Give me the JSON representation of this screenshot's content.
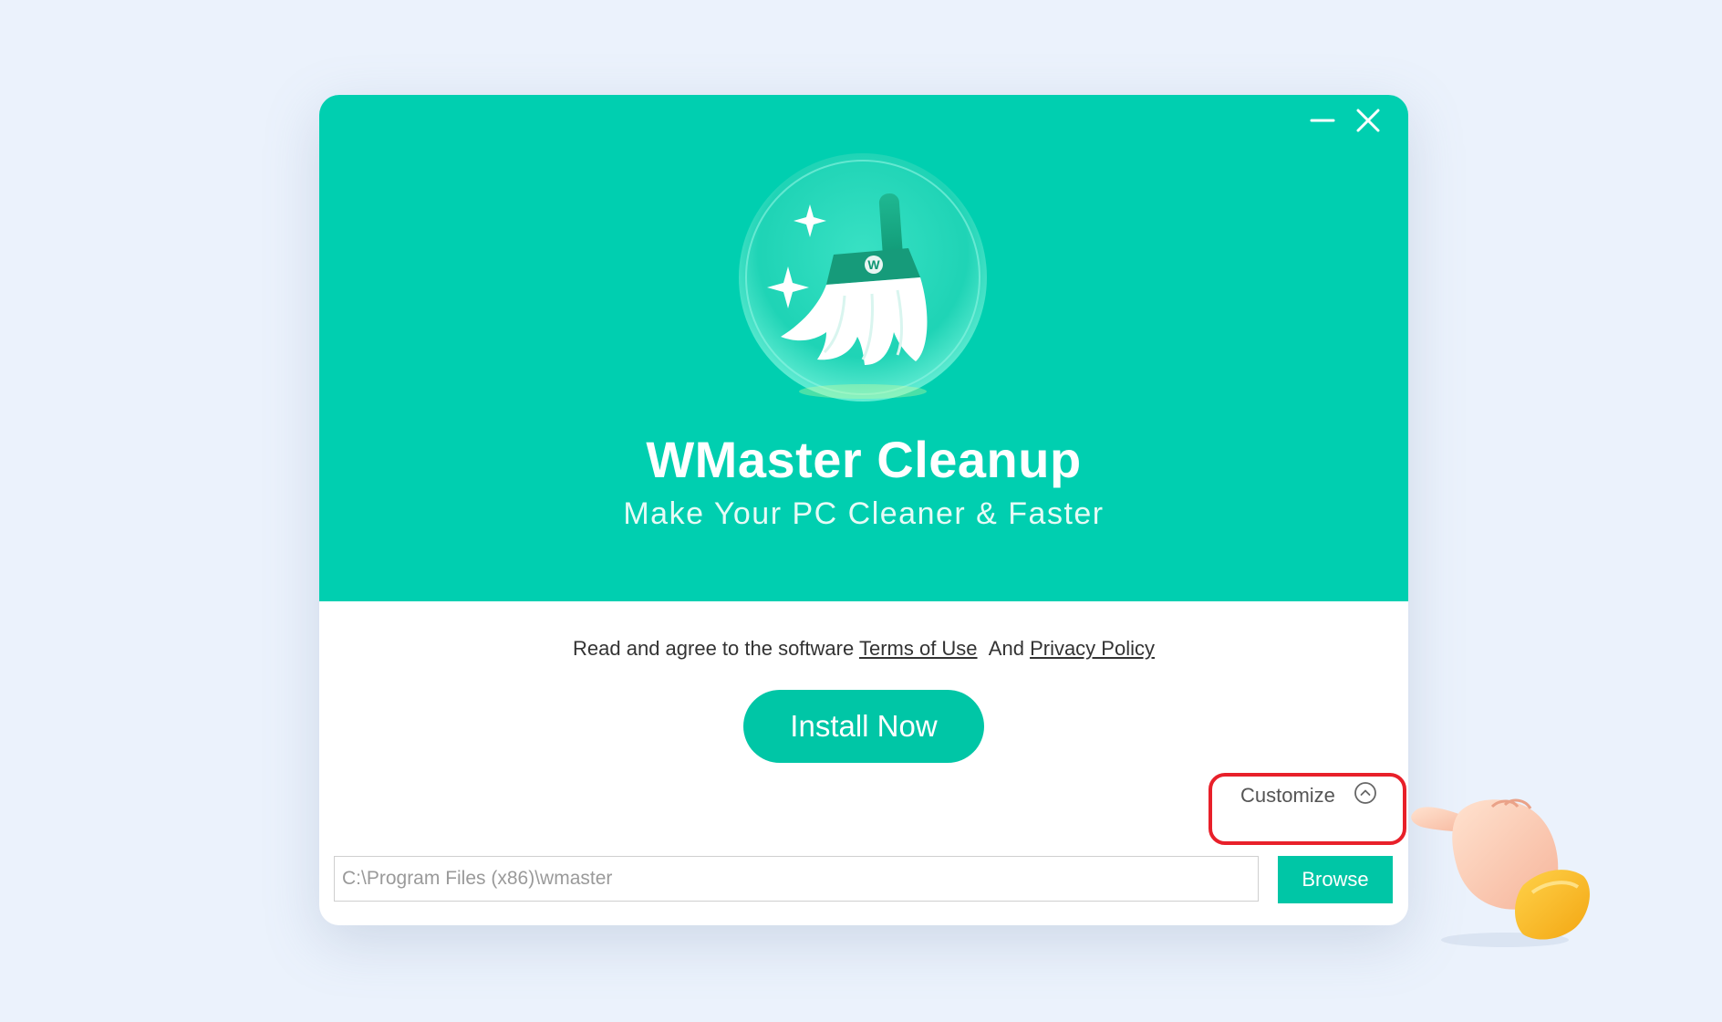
{
  "window": {
    "minimize_icon": "minimize-icon",
    "close_icon": "close-icon"
  },
  "hero": {
    "logo_icon": "broom-logo-icon",
    "logo_letter": "W",
    "title": "WMaster Cleanup",
    "subtitle": "Make Your PC Cleaner & Faster"
  },
  "agreement": {
    "prefix": "Read and agree to the software",
    "terms_link": "Terms of Use",
    "and_text": "And",
    "privacy_link": "Privacy Policy"
  },
  "install_button": "Install Now",
  "customize": {
    "label": "Customize",
    "icon": "chevron-up-circle-icon"
  },
  "install_path": {
    "value": "C:\\Program Files (x86)\\wmaster"
  },
  "browse_button": "Browse",
  "annotation": {
    "pointer_icon": "pointing-hand-icon"
  },
  "colors": {
    "accent": "#00cfb0",
    "button": "#00c6a6",
    "highlight": "#e8202a",
    "background": "#ebf2fc"
  }
}
